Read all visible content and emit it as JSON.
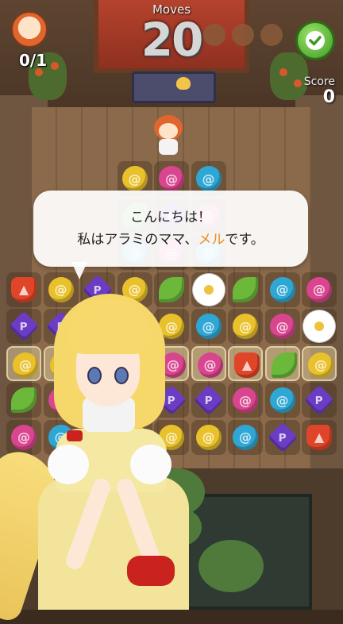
{
  "hud": {
    "goal_count": "0/1",
    "moves_label": "Moves",
    "moves_value": "20",
    "score_label": "Score",
    "score_value": "0"
  },
  "dialog": {
    "line1": "こんにちは！",
    "line2_prefix": "私はアラミのママ、",
    "line2_name": "メル",
    "line2_suffix": "です。"
  },
  "colors": {
    "name_highlight": "#f08a1c",
    "confirm_button": "#4fae2c",
    "gem_red": "#e0452a",
    "gem_yellow": "#e9c12b",
    "gem_purple": "#6b3cc4",
    "gem_pink": "#d9458f",
    "gem_blue": "#2fa7d4",
    "gem_green": "#6bb83a"
  },
  "board": {
    "rows": [
      [
        null,
        null,
        null,
        "yellow",
        "pink",
        "blue",
        null,
        null,
        null
      ],
      [
        null,
        null,
        null,
        "green",
        "purple",
        "pink",
        null,
        null,
        null
      ],
      [
        null,
        null,
        null,
        "blue",
        "pink",
        "blue",
        null,
        null,
        null
      ],
      [
        "red",
        "yellow",
        "purple",
        "yellow",
        "green",
        "flower",
        "green",
        "blue",
        "pink"
      ],
      [
        "purple",
        "purple",
        "yellow",
        "pink",
        "yellow",
        "blue",
        "yellow",
        "pink",
        "flower"
      ],
      [
        "yellow",
        "yellow",
        "purple",
        "pink",
        "pink",
        "pink",
        "red",
        "green",
        "yellow"
      ],
      [
        "green",
        "pink",
        "blue",
        "purple",
        "purple",
        "purple",
        "pink",
        "blue",
        "purple"
      ],
      [
        "pink",
        "blue",
        "yellow",
        "yellow",
        "yellow",
        "yellow",
        "blue",
        "purple",
        "red"
      ]
    ],
    "highlight_row": 5
  }
}
